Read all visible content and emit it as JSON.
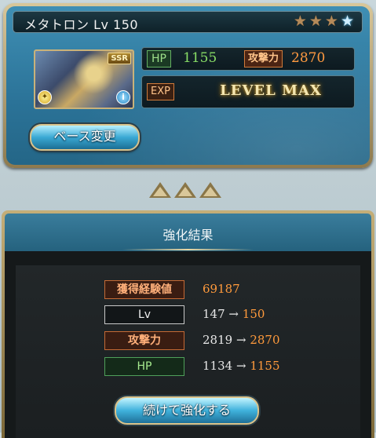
{
  "character": {
    "name_level": "メタトロン Lv 150",
    "stars": [
      {
        "type": "bronze",
        "glyph": "★"
      },
      {
        "type": "bronze",
        "glyph": "★"
      },
      {
        "type": "bronze",
        "glyph": "★"
      },
      {
        "type": "blue",
        "glyph": "★"
      }
    ],
    "rarity": "SSR",
    "hp_label": "HP",
    "hp_value": "1155",
    "atk_label": "攻撃力",
    "atk_value": "2870",
    "exp_label": "EXP",
    "exp_status": "LEVEL MAX"
  },
  "base_button": "ベース変更",
  "result": {
    "title": "強化結果",
    "rows": [
      {
        "label": "獲得経験値",
        "value": "69187"
      },
      {
        "label": "Lv",
        "before": "147",
        "arrow": "→",
        "after": "150"
      },
      {
        "label": "攻撃力",
        "before": "2819",
        "arrow": "→",
        "after": "2870"
      },
      {
        "label": "HP",
        "before": "1134",
        "arrow": "→",
        "after": "1155"
      }
    ]
  },
  "continue_button": "続けて強化する",
  "icons": {
    "element": "light-element-icon",
    "info": "info-icon",
    "progress": "triangle-arrow-icon"
  }
}
